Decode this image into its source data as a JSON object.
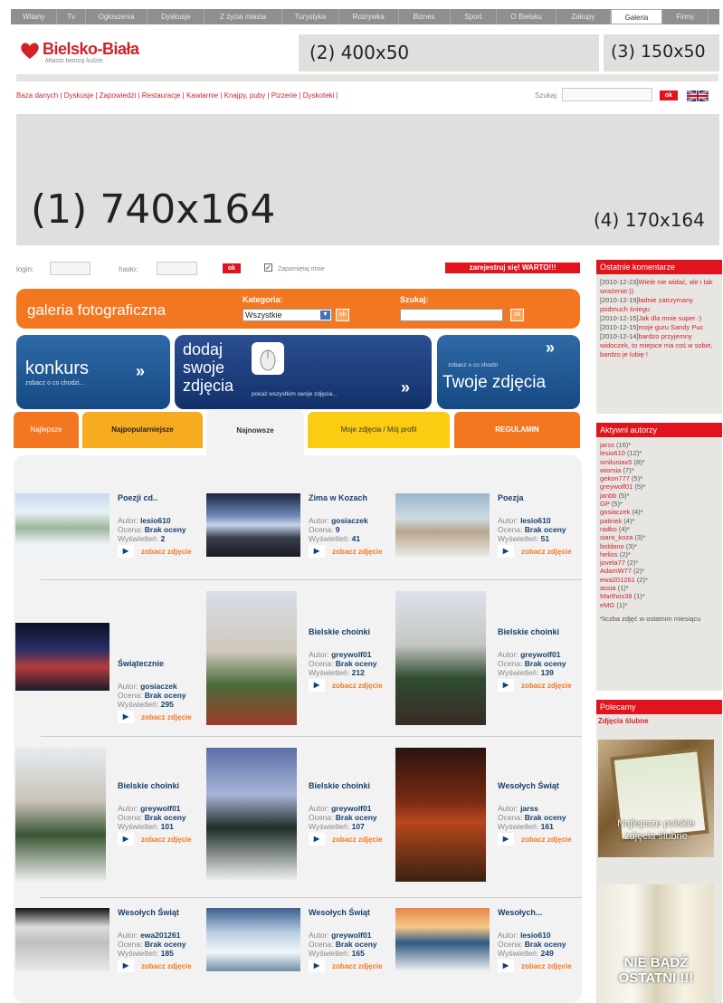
{
  "topnav": [
    "Witany",
    "Tv",
    "Ogłoszenia",
    "Dyskusje",
    "Z życia miasta",
    "Turystyka",
    "Rozrywka",
    "Biznes",
    "Sport",
    "O Bielsku",
    "Zakupy",
    "Galeria",
    "Firmy"
  ],
  "logo": {
    "name": "Bielsko-Biała",
    "tagline": "Miasto tworzą ludzie."
  },
  "ads": {
    "ad1": "(1) 740x164",
    "ad2": "(2) 400x50",
    "ad3": "(3) 150x50",
    "ad4": "(4) 170x164"
  },
  "catlinks": "Baza danych | Dyskusje | Zapowiedzi | Restauracje | Kawiarnie | Knajpy, puby | Pizzerie | Dyskoteki |",
  "search": {
    "label": "Szukaj",
    "ok": "ok"
  },
  "login": {
    "login_label": "login:",
    "pass_label": "hasło:",
    "ok": "ok",
    "remember": "Zapamiętaj mnie",
    "register": "zarejestruj się! WARTO!!!"
  },
  "gallery": {
    "title": "galeria fotograficzna",
    "cat_label": "Kategoria:",
    "cat_value": "Wszystkie",
    "ok": "ok",
    "search_label": "Szukaj:"
  },
  "promo": {
    "konkurs": "konkurs",
    "konkurs_sub": "zobacz o co chodzi...",
    "dodaj1": "dodaj",
    "dodaj2": "swoje",
    "dodaj3": "zdjęcia",
    "dodaj_sub": "pokaż wszystkim swoje zdjęcia...",
    "twoje_sub": "zobacz o co chodzi",
    "twoje": "Twoje zdjęcia"
  },
  "tabs": [
    "Najlepsze",
    "Najpopularniejsze",
    "Najnowsze",
    "Moje zdjęcia / Mój profil",
    "REGULAMIN"
  ],
  "labels": {
    "autor": "Autor:",
    "ocena": "Ocena:",
    "wys": "Wyświetleń:",
    "zobacz": "zobacz zdjęcie"
  },
  "photos": [
    {
      "title": "Poezji cd..",
      "author": "lesio610",
      "rating": "Brak oceny",
      "views": "2"
    },
    {
      "title": "Zima w Kozach",
      "author": "gosiaczek",
      "rating": "9",
      "views": "41"
    },
    {
      "title": "Poezja",
      "author": "lesio610",
      "rating": "Brak oceny",
      "views": "51"
    },
    {
      "title": "Świątecznie",
      "author": "gosiaczek",
      "rating": "Brak oceny",
      "views": "295"
    },
    {
      "title": "Bielskie choinki",
      "author": "greywolf01",
      "rating": "Brak oceny",
      "views": "212"
    },
    {
      "title": "Bielskie choinki",
      "author": "greywolf01",
      "rating": "Brak oceny",
      "views": "139"
    },
    {
      "title": "Bielskie choinki",
      "author": "greywolf01",
      "rating": "Brak oceny",
      "views": "101"
    },
    {
      "title": "Bielskie choinki",
      "author": "greywolf01",
      "rating": "Brak oceny",
      "views": "107"
    },
    {
      "title": "Wesołych Świąt",
      "author": "jarss",
      "rating": "Brak oceny",
      "views": "161"
    },
    {
      "title": "Wesołych Świąt",
      "author": "ewa201261",
      "rating": "Brak oceny",
      "views": "185"
    },
    {
      "title": "Wesołych Świąt",
      "author": "greywolf01",
      "rating": "Brak oceny",
      "views": "165"
    },
    {
      "title": "Wesołych...",
      "author": "lesio610",
      "rating": "Brak oceny",
      "views": "249"
    }
  ],
  "sidebar": {
    "comments_title": "Ostatnie komentarze",
    "comments": [
      {
        "date": "[2010-12-23]",
        "text": "Wiele nie widać, ale i tak wrażenie:))"
      },
      {
        "date": "[2010-12-19]",
        "text": "ładnie zatrzymany podmuch śniegu"
      },
      {
        "date": "[2010-12-15]",
        "text": "Jak dla mnie super :)"
      },
      {
        "date": "[2010-12-15]",
        "text": "moje guru Sandy Puc"
      },
      {
        "date": "[2010-12-14]",
        "text": "bardzo przyjemny widoczek, to miejsce ma coś w sobie, bardzo je lubię !"
      }
    ],
    "authors_title": "Aktywni autorzy",
    "authors": [
      {
        "name": "jarss",
        "count": "(16)*"
      },
      {
        "name": "lesio610",
        "count": "(12)*"
      },
      {
        "name": "smiluniax5",
        "count": "(8)*"
      },
      {
        "name": "wiorsia",
        "count": "(7)*"
      },
      {
        "name": "gekon777",
        "count": "(5)*"
      },
      {
        "name": "greywolf01",
        "count": "(5)*"
      },
      {
        "name": "janbb",
        "count": "(5)*"
      },
      {
        "name": "GP",
        "count": "(5)*"
      },
      {
        "name": "gosiaczek",
        "count": "(4)*"
      },
      {
        "name": "patinek",
        "count": "(4)*"
      },
      {
        "name": "radko",
        "count": "(4)*"
      },
      {
        "name": "siara_koza",
        "count": "(3)*"
      },
      {
        "name": "boldano",
        "count": "(3)*"
      },
      {
        "name": "helios",
        "count": "(2)*"
      },
      {
        "name": "jovela77",
        "count": "(2)*"
      },
      {
        "name": "AdamW77",
        "count": "(2)*"
      },
      {
        "name": "ewa201261",
        "count": "(2)*"
      },
      {
        "name": "assia",
        "count": "(1)*"
      },
      {
        "name": "Marthos38",
        "count": "(1)*"
      },
      {
        "name": "eMG",
        "count": "(1)*"
      }
    ],
    "authors_note": "*liczba zdjęć w ostatnim miesiącu",
    "polecamy_title": "Polecamy",
    "polecamy_link": "Zdjęcia ślubne",
    "banner1": "Najlepsze polskie zdjęcia ślubne",
    "banner2": "NIE BĄDŹ OSTATNI !!!"
  },
  "colors": {
    "red": "#e0141d",
    "orange": "#f37721",
    "blue": "#16406c"
  }
}
